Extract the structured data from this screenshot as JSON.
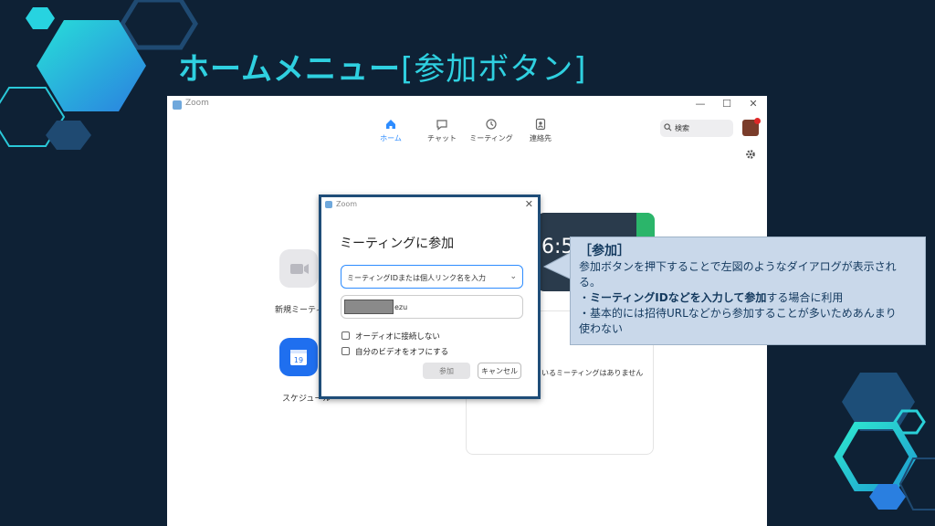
{
  "slide": {
    "title_main": "ホームメニュー",
    "title_bracket": "[参加ボタン]"
  },
  "zoom_window": {
    "title": "Zoom",
    "controls": {
      "minimize": "—",
      "maximize": "☐",
      "close": "✕"
    },
    "nav": [
      {
        "label": "ホーム",
        "icon": "home-icon",
        "active": true
      },
      {
        "label": "チャット",
        "icon": "chat-icon",
        "active": false
      },
      {
        "label": "ミーティング",
        "icon": "clock-icon",
        "active": false
      },
      {
        "label": "連絡先",
        "icon": "contacts-icon",
        "active": false
      }
    ],
    "search_placeholder": "検索",
    "tiles": [
      {
        "label": "新規ミーティ",
        "icon": "video-camera-icon",
        "color": "#e7e7ea"
      },
      {
        "label": "スケジュール",
        "icon": "calendar-icon",
        "color": "#1f6fef",
        "day": "19"
      }
    ],
    "clock_text": "6:5",
    "no_meeting_text": "いるミーティングはありません"
  },
  "dialog": {
    "title": "Zoom",
    "close": "✕",
    "heading": "ミーティングに参加",
    "meeting_id_placeholder": "ミーティングIDまたは個人リンク名を入力",
    "name_value": "ezu",
    "options": [
      "オーディオに接続しない",
      "自分のビデオをオフにする"
    ],
    "join_label": "参加",
    "cancel_label": "キャンセル"
  },
  "callout": {
    "heading": "［参加］",
    "line1": "参加ボタンを押下することで左図のようなダイアログが表示され",
    "line2": "る。",
    "line3_prefix": "・",
    "line3_bold": "ミーティングIDなどを入力して参加",
    "line3_suffix": "する場合に利用",
    "line4": "・基本的には招待URLなどから参加することが多いためあんまり",
    "line5": "使わない"
  },
  "colors": {
    "background": "#0e2135",
    "title": "#2fd0e0",
    "zoom_blue": "#2d8cff",
    "callout_bg": "#c9d8ea",
    "dialog_border": "#1f4d78"
  }
}
